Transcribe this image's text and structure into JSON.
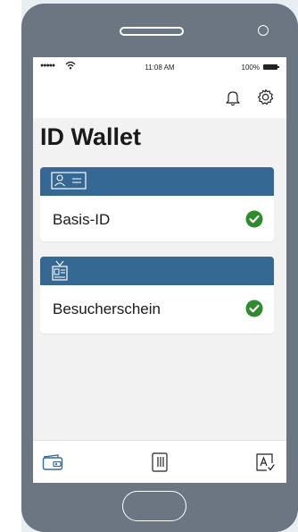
{
  "status_bar": {
    "signal": "●●●●●",
    "time": "11:08 AM",
    "battery": "100%"
  },
  "header": {
    "title": "ID Wallet",
    "icons": [
      "bell-icon",
      "gear-icon"
    ]
  },
  "cards": [
    {
      "label": "Basis-ID",
      "icon": "id-card-icon",
      "status": "verified"
    },
    {
      "label": "Besucherschein",
      "icon": "visitor-badge-icon",
      "status": "verified"
    }
  ],
  "bottom_nav": [
    "wallet-icon",
    "qr-scan-icon",
    "sign-document-icon"
  ],
  "colors": {
    "card_header": "#356893",
    "check": "#2e8b2e",
    "active_nav": "#356893",
    "phone_frame": "#6b7682"
  }
}
